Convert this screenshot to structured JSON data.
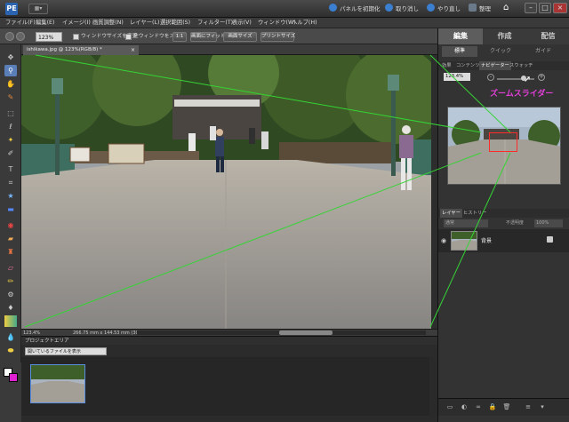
{
  "titlebar": {
    "logo": "PE",
    "mode": "▦▾",
    "reset_panels_label": "パネルを初期化",
    "undo_label": "取り消し",
    "redo_label": "やり直し",
    "organize_label": "整理",
    "home_icon": "home-icon"
  },
  "menubar": {
    "items": [
      "ファイル(F)",
      "編集(E)",
      "イメージ(I)",
      "画質調整(N)",
      "レイヤー(L)",
      "選択範囲(S)",
      "フィルター(T)",
      "表示(V)",
      "ウィンドウ(W)",
      "ヘルプ(H)"
    ]
  },
  "options": {
    "zoom_value": "123%",
    "resize_windows_label": "ウィンドウサイズを変更",
    "zoom_all_windows_label": "全ウィンドウをズーム",
    "btn_1to1": "1:1",
    "btn_fit_screen": "画面にフィット",
    "btn_fill_screen": "画面サイズ",
    "btn_print_size": "プリントサイズ"
  },
  "document": {
    "tab_label": "ishikawa.jpg @ 123%(RGB/8) *",
    "status_zoom": "123.4%",
    "status_size": "266.75 mm x 144.53 mm (300 ppi)"
  },
  "project_bin": {
    "title": "プロジェクトエリア",
    "dropdown_value": "開いているファイルを表示"
  },
  "right_panel": {
    "tab_edit": "編集",
    "tab_create": "作成",
    "tab_share": "配信",
    "sub_standard": "標準",
    "sub_quick": "クイック",
    "sub_guide": "ガイド",
    "panel_tabs": [
      "効果",
      "コンテンツ",
      "ナビゲーター",
      "スウォッチ"
    ],
    "nav_zoom": "123.4%",
    "zoom_slider_fraction": 0.72,
    "annotation": "ズームスライダー",
    "layers_tabs": [
      "レイヤー",
      "ヒストリー"
    ],
    "layers_mode": "通常",
    "layers_opacity_label": "不透明度",
    "layers_opacity": "100%",
    "layer_name": "背景"
  },
  "colors": {
    "annotation": "#e23fd8",
    "nav_box": "#ff2a2a",
    "zoom_lines": "#35d435",
    "foreground": "#ffffff",
    "background": "#e01fd0"
  }
}
